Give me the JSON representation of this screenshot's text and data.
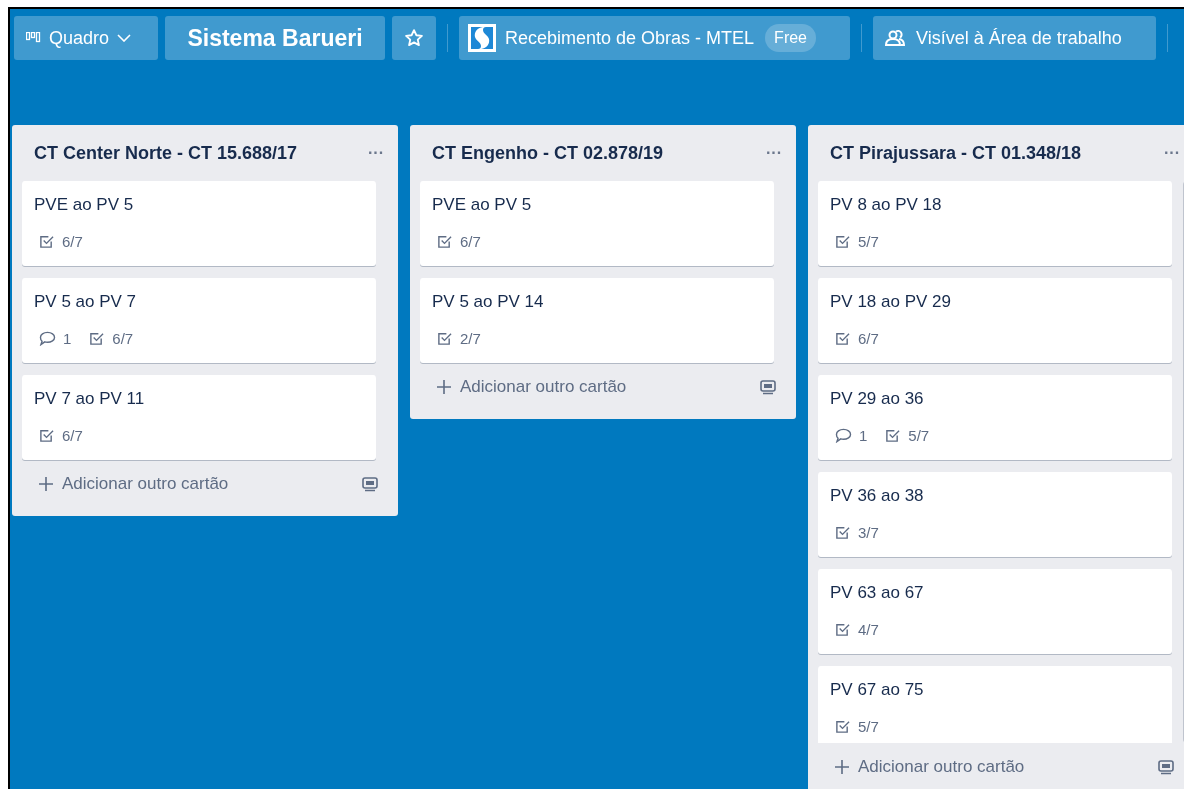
{
  "header": {
    "board_menu": "Quadro",
    "board_title": "Sistema Barueri",
    "workspace": "Recebimento de Obras - MTEL",
    "workspace_badge": "Free",
    "visibility": "Visível à Área de trabalho"
  },
  "lists": [
    {
      "title": "CT Center Norte - CT 15.688/17",
      "menu": "···",
      "cards": [
        {
          "title": "PVE ao PV 5",
          "checklist": "6/7"
        },
        {
          "title": "PV 5 ao PV 7",
          "comments": "1",
          "checklist": "6/7"
        },
        {
          "title": "PV 7 ao PV 11",
          "checklist": "6/7"
        }
      ],
      "composer": "Adicionar outro cartão"
    },
    {
      "title": "CT Engenho - CT 02.878/19",
      "menu": "···",
      "cards": [
        {
          "title": "PVE ao PV 5",
          "checklist": "6/7"
        },
        {
          "title": "PV 5 ao PV 14",
          "checklist": "2/7"
        }
      ],
      "composer": "Adicionar outro cartão"
    },
    {
      "title": "CT Pirajussara - CT 01.348/18",
      "menu": "···",
      "cards": [
        {
          "title": "PV 8 ao PV 18",
          "checklist": "5/7"
        },
        {
          "title": "PV 18 ao PV 29",
          "checklist": "6/7"
        },
        {
          "title": "PV 29 ao 36",
          "comments": "1",
          "checklist": "5/7"
        },
        {
          "title": "PV 36 ao 38",
          "checklist": "3/7"
        },
        {
          "title": "PV 63 ao 67",
          "checklist": "4/7"
        },
        {
          "title": "PV 67 ao 75",
          "checklist": "5/7"
        }
      ],
      "composer": "Adicionar outro cartão"
    }
  ]
}
